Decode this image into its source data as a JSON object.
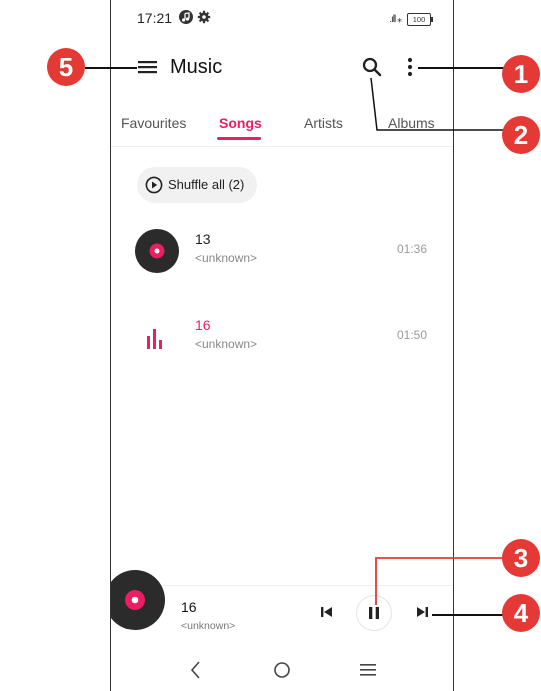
{
  "status_bar": {
    "time": "17:21",
    "signal": ".ıll ⁎",
    "battery": "100"
  },
  "app_bar": {
    "title": "Music"
  },
  "tabs": [
    {
      "label": "Favourites",
      "active": false
    },
    {
      "label": "Songs",
      "active": true
    },
    {
      "label": "Artists",
      "active": false
    },
    {
      "label": "Albums",
      "active": false
    }
  ],
  "shuffle": {
    "label": "Shuffle all (2)"
  },
  "songs": [
    {
      "title": "13",
      "artist": "<unknown>",
      "duration": "01:36",
      "playing": false
    },
    {
      "title": "16",
      "artist": "<unknown>",
      "duration": "01:50",
      "playing": true
    }
  ],
  "now_playing": {
    "title": "16",
    "artist": "<unknown>"
  },
  "callouts": [
    "1",
    "2",
    "3",
    "4",
    "5"
  ],
  "colors": {
    "accent": "#e91e63",
    "callout": "#e53935",
    "disc": "#2b2b2b"
  }
}
